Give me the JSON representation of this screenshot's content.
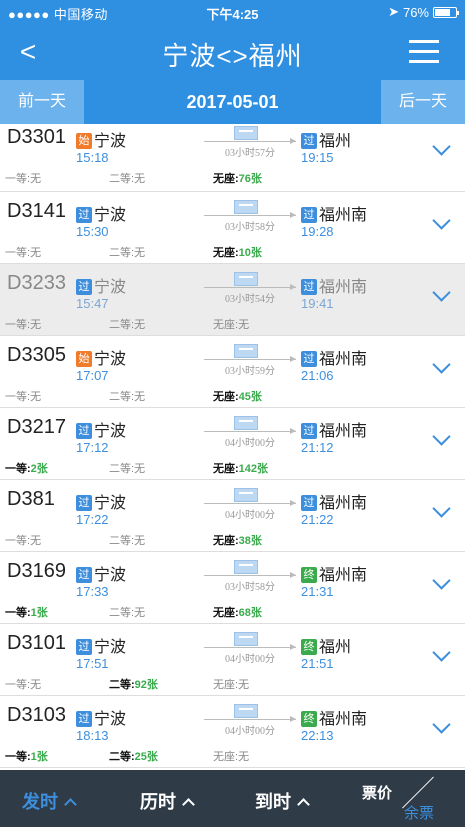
{
  "status_bar": {
    "carrier": "●●●●● 中国移动",
    "time": "下午4:25",
    "battery": "76%",
    "battery_level": 0.76
  },
  "nav": {
    "back_label": "<",
    "title": "宁波<>福州"
  },
  "date_bar": {
    "prev_label": "前一天",
    "date": "2017-05-01",
    "next_label": "后一天"
  },
  "trains": [
    {
      "no": "D3301",
      "dep_badge": "始",
      "dep_badge_type": "start",
      "dep_station": "宁波",
      "dep_time": "15:18",
      "duration": "03小时57分",
      "arr_badge": "过",
      "arr_badge_type": "pass",
      "arr_station": "福州",
      "arr_time": "19:15",
      "seat1_label": "一等:",
      "seat1_value": "无",
      "seat2_label": "二等:",
      "seat2_value": "无",
      "seat3_label": "无座:",
      "seat3_value": "76张"
    },
    {
      "no": "D3141",
      "dep_badge": "过",
      "dep_badge_type": "pass",
      "dep_station": "宁波",
      "dep_time": "15:30",
      "duration": "03小时58分",
      "arr_badge": "过",
      "arr_badge_type": "pass",
      "arr_station": "福州南",
      "arr_time": "19:28",
      "seat1_label": "一等:",
      "seat1_value": "无",
      "seat2_label": "二等:",
      "seat2_value": "无",
      "seat3_label": "无座:",
      "seat3_value": "10张"
    },
    {
      "no": "D3233",
      "dep_badge": "过",
      "dep_badge_type": "pass",
      "dep_station": "宁波",
      "dep_time": "15:47",
      "duration": "03小时54分",
      "arr_badge": "过",
      "arr_badge_type": "pass",
      "arr_station": "福州南",
      "arr_time": "19:41",
      "seat1_label": "一等:",
      "seat1_value": "无",
      "seat2_label": "二等:",
      "seat2_value": "无",
      "seat3_label": "无座:",
      "seat3_value": "无"
    },
    {
      "no": "D3305",
      "dep_badge": "始",
      "dep_badge_type": "start",
      "dep_station": "宁波",
      "dep_time": "17:07",
      "duration": "03小时59分",
      "arr_badge": "过",
      "arr_badge_type": "pass",
      "arr_station": "福州南",
      "arr_time": "21:06",
      "seat1_label": "一等:",
      "seat1_value": "无",
      "seat2_label": "二等:",
      "seat2_value": "无",
      "seat3_label": "无座:",
      "seat3_value": "45张"
    },
    {
      "no": "D3217",
      "dep_badge": "过",
      "dep_badge_type": "pass",
      "dep_station": "宁波",
      "dep_time": "17:12",
      "duration": "04小时00分",
      "arr_badge": "过",
      "arr_badge_type": "pass",
      "arr_station": "福州南",
      "arr_time": "21:12",
      "seat1_label": "一等:",
      "seat1_value": "2张",
      "seat2_label": "二等:",
      "seat2_value": "无",
      "seat3_label": "无座:",
      "seat3_value": "142张"
    },
    {
      "no": "D381",
      "dep_badge": "过",
      "dep_badge_type": "pass",
      "dep_station": "宁波",
      "dep_time": "17:22",
      "duration": "04小时00分",
      "arr_badge": "过",
      "arr_badge_type": "pass",
      "arr_station": "福州南",
      "arr_time": "21:22",
      "seat1_label": "一等:",
      "seat1_value": "无",
      "seat2_label": "二等:",
      "seat2_value": "无",
      "seat3_label": "无座:",
      "seat3_value": "38张"
    },
    {
      "no": "D3169",
      "dep_badge": "过",
      "dep_badge_type": "pass",
      "dep_station": "宁波",
      "dep_time": "17:33",
      "duration": "03小时58分",
      "arr_badge": "终",
      "arr_badge_type": "end",
      "arr_station": "福州南",
      "arr_time": "21:31",
      "seat1_label": "一等:",
      "seat1_value": "1张",
      "seat2_label": "二等:",
      "seat2_value": "无",
      "seat3_label": "无座:",
      "seat3_value": "68张"
    },
    {
      "no": "D3101",
      "dep_badge": "过",
      "dep_badge_type": "pass",
      "dep_station": "宁波",
      "dep_time": "17:51",
      "duration": "04小时00分",
      "arr_badge": "终",
      "arr_badge_type": "end",
      "arr_station": "福州",
      "arr_time": "21:51",
      "seat1_label": "一等:",
      "seat1_value": "无",
      "seat2_label": "二等:",
      "seat2_value": "92张",
      "seat3_label": "无座:",
      "seat3_value": "无"
    },
    {
      "no": "D3103",
      "dep_badge": "过",
      "dep_badge_type": "pass",
      "dep_station": "宁波",
      "dep_time": "18:13",
      "duration": "04小时00分",
      "arr_badge": "终",
      "arr_badge_type": "end",
      "arr_station": "福州南",
      "arr_time": "22:13",
      "seat1_label": "一等:",
      "seat1_value": "1张",
      "seat2_label": "二等:",
      "seat2_value": "25张",
      "seat3_label": "无座:",
      "seat3_value": "无"
    }
  ],
  "tab_bar": {
    "departure_label": "发时",
    "duration_label": "历时",
    "arrival_label": "到时",
    "price_label": "票价",
    "remaining_label": "余票"
  },
  "colors": {
    "primary": "#2f8fe0",
    "available": "#3aab4c",
    "start_badge": "#f07b2a",
    "pass_badge": "#3d8fde",
    "end_badge": "#3aab4c",
    "tab_bar": "#2f3b47"
  }
}
